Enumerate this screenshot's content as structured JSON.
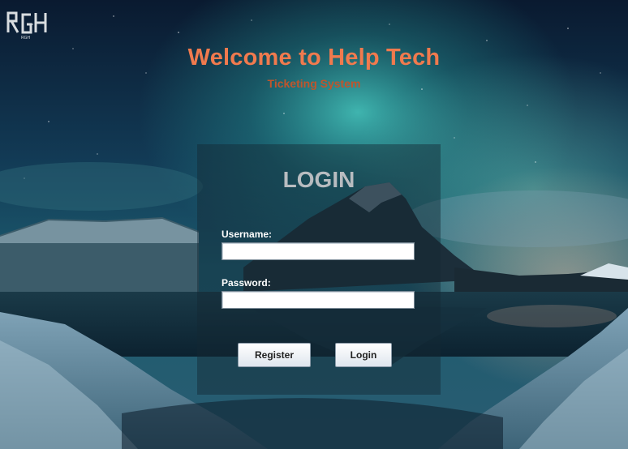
{
  "header": {
    "title": "Welcome to Help Tech",
    "subtitle": "Ticketing System"
  },
  "logo": {
    "text": "RGH",
    "icon": "rgh-logo"
  },
  "login": {
    "heading": "LOGIN",
    "username_label": "Username:",
    "username_value": "",
    "password_label": "Password:",
    "password_value": "",
    "register_button": "Register",
    "login_button": "Login"
  },
  "colors": {
    "title": "#f07a4e",
    "subtitle": "#c0552c",
    "heading": "#b8bcc0"
  }
}
